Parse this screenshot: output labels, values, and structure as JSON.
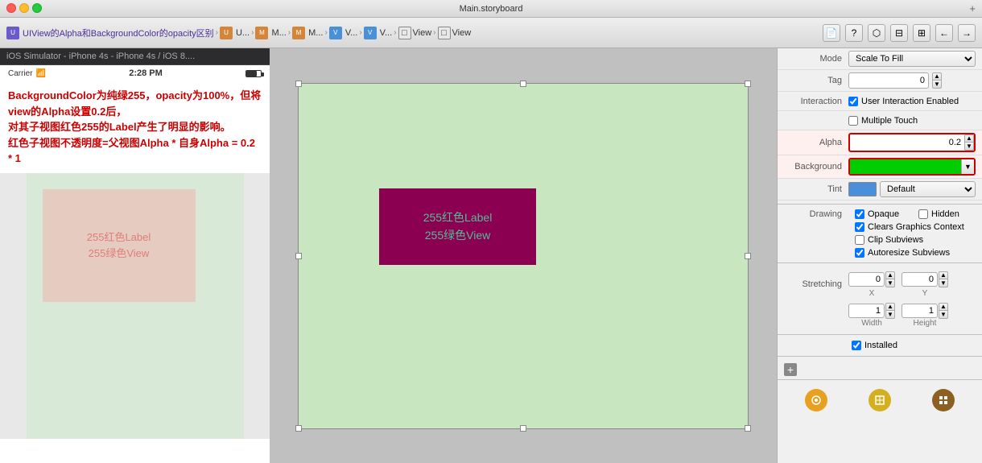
{
  "window": {
    "title": "Main.storyboard",
    "controls": {
      "close": "×",
      "minimize": "–",
      "maximize": "+"
    }
  },
  "simulator": {
    "label": "iOS Simulator - iPhone 4s - iPhone 4s / iOS 8....",
    "status_bar": {
      "carrier": "Carrier",
      "wifi_icon": "wifi",
      "time": "2:28 PM",
      "battery": "battery"
    },
    "annotation_line1": "BackgroundColor为纯绿255，opacity为100%，但将view的Alpha设置0.2后，",
    "annotation_line2": "对其子视图红色255的Label产生了明显的影响。",
    "annotation_line3": "红色子视图不透明度=父视图Alpha * 自身Alpha = 0.2 * 1",
    "inner_label_line1": "255红色Label",
    "inner_label_line2": "255绿色View"
  },
  "breadcrumb": {
    "items": [
      {
        "icon": "U",
        "icon_color": "purple",
        "label": "UIView的Alpha和BackgroundColor的opacity区别"
      },
      {
        "icon": ">",
        "label": "U..."
      },
      {
        "icon": ">",
        "label": "M..."
      },
      {
        "icon": ">",
        "label": "M..."
      },
      {
        "icon": ">",
        "label": "V..."
      },
      {
        "icon": ">",
        "label": "V..."
      },
      {
        "icon_color": "blue",
        "label": "View"
      },
      {
        "icon_color": "blue",
        "label": "View"
      }
    ]
  },
  "canvas": {
    "inner_view": {
      "label_line1": "255红色Label",
      "label_line2": "255绿色View"
    }
  },
  "inspector": {
    "mode_label": "Mode",
    "mode_value": "Scale To Fill",
    "tag_label": "Tag",
    "tag_value": "0",
    "interaction_label": "Interaction",
    "user_interaction_label": "User Interaction Enabled",
    "multiple_touch_label": "Multiple Touch",
    "alpha_label": "Alpha",
    "alpha_value": "0.2",
    "background_label": "Background",
    "tint_label": "Tint",
    "tint_value": "Default",
    "drawing_label": "Drawing",
    "opaque_label": "Opaque",
    "hidden_label": "Hidden",
    "clears_graphics_label": "Clears Graphics Context",
    "clip_subviews_label": "Clip Subviews",
    "autoresize_label": "Autoresize Subviews",
    "stretching_label": "Stretching",
    "x_label": "X",
    "x_value": "0",
    "y_label": "Y",
    "y_value": "0",
    "width_label": "Width",
    "width_value": "1",
    "height_label": "Height",
    "height_value": "1",
    "installed_label": "Installed"
  },
  "bottom_icons": [
    {
      "label": "obj-icon",
      "color": "orange",
      "symbol": "⊙"
    },
    {
      "label": "box-icon",
      "color": "yellow",
      "symbol": "◫"
    },
    {
      "label": "grid-icon",
      "color": "brown",
      "symbol": "⊞"
    }
  ],
  "toolbar_buttons": {
    "file": "📄",
    "help": "?",
    "share": "⬡",
    "inspector": "⊟",
    "sidebar": "⊞",
    "back": "←",
    "forward": "→"
  }
}
